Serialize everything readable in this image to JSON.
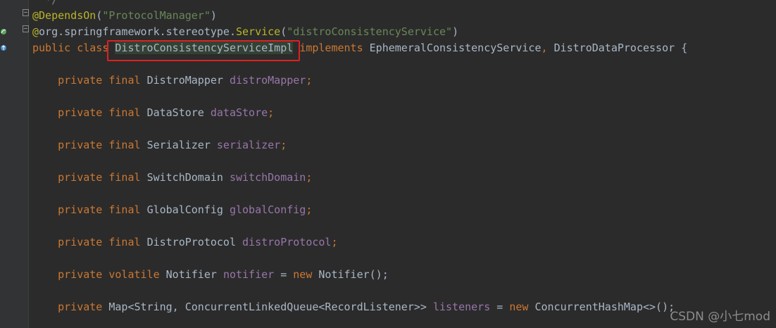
{
  "colors": {
    "background": "#2b2b2b",
    "gutter": "#313335",
    "keyword": "#cc7832",
    "annotation": "#bbb529",
    "string": "#6a8759",
    "field": "#9876aa",
    "text": "#a9b7c6",
    "highlight": "#344134",
    "selection_box": "#e02020"
  },
  "gutter": {
    "icons": [
      "spring-bean-icon",
      "implements-icon"
    ]
  },
  "code": {
    "comment_tail": "*/",
    "anno1": {
      "at": "@DependsOn",
      "open": "(",
      "arg": "\"ProtocolManager\"",
      "close": ")"
    },
    "anno2": {
      "at": "@",
      "pkg": "org.springframework.stereotype.",
      "name": "Service",
      "open": "(",
      "arg": "\"distroConsistencyService\"",
      "close": ")"
    },
    "class_decl": {
      "public": "public",
      "class": "class",
      "name": "DistroConsistencyServiceImpl",
      "implements": "implements",
      "iface1": "EphemeralConsistencyService",
      "comma": ",",
      "iface2": "DistroDataProcessor",
      "brace": "{"
    },
    "fields": [
      {
        "modifiers": "private final",
        "type": "DistroMapper",
        "name": "distroMapper",
        "suffix": ";"
      },
      {
        "modifiers": "private final",
        "type": "DataStore",
        "name": "dataStore",
        "suffix": ";"
      },
      {
        "modifiers": "private final",
        "type": "Serializer",
        "name": "serializer",
        "suffix": ";"
      },
      {
        "modifiers": "private final",
        "type": "SwitchDomain",
        "name": "switchDomain",
        "suffix": ";"
      },
      {
        "modifiers": "private final",
        "type": "GlobalConfig",
        "name": "globalConfig",
        "suffix": ";"
      },
      {
        "modifiers": "private final",
        "type": "DistroProtocol",
        "name": "distroProtocol",
        "suffix": ";"
      }
    ],
    "notifier": {
      "modifiers": "private volatile",
      "type": "Notifier",
      "name": "notifier",
      "eq": "=",
      "new": "new",
      "ctor": "Notifier();"
    },
    "listeners": {
      "modifier": "private",
      "type": "Map<String, ConcurrentLinkedQueue<RecordListener>>",
      "name": "listeners",
      "eq": "=",
      "new": "new",
      "ctor": "ConcurrentHashMap<>();"
    }
  },
  "watermark": "CSDN @小七mod"
}
